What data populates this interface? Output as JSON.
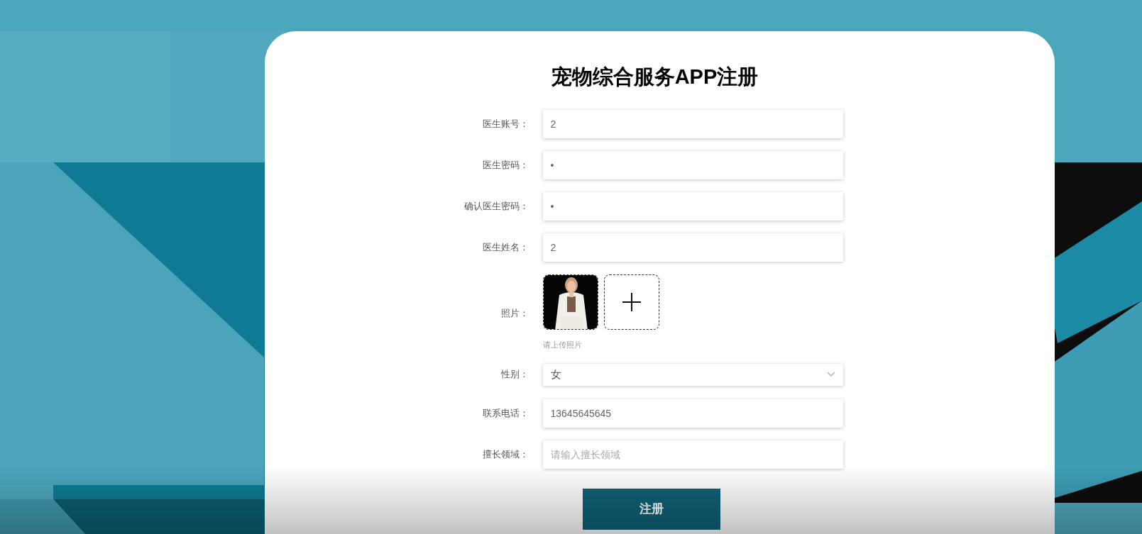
{
  "title": "宠物综合服务APP注册",
  "fields": [
    {
      "kind": "text",
      "label": "医生账号：",
      "value": "2"
    },
    {
      "kind": "text",
      "label": "医生密码：",
      "value": "•"
    },
    {
      "kind": "text",
      "label": "确认医生密码：",
      "value": "•"
    },
    {
      "kind": "text",
      "label": "医生姓名：",
      "value": "2"
    },
    {
      "label": "照片：",
      "hint": "请上传照片"
    },
    {
      "kind": "select",
      "label": "性别：",
      "value": "女"
    },
    {
      "kind": "text",
      "label": "联系电话：",
      "value": "13645645645"
    },
    {
      "kind": "text",
      "label": "擅长领域：",
      "placeholder": "请输入擅长领域"
    }
  ],
  "submit": "注册"
}
